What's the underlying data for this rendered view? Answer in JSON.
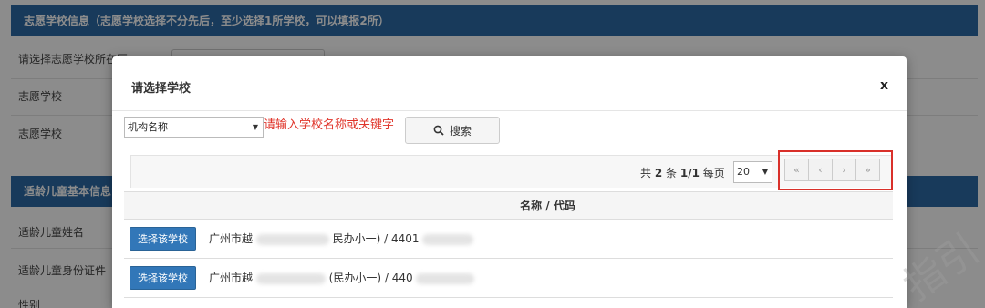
{
  "background": {
    "section1_title": "志愿学校信息（志愿学校选择不分先后，至少选择1所学校，可以填报2所）",
    "label_area": "请选择志愿学校所在区",
    "label_school1": "志愿学校",
    "label_school2": "志愿学校",
    "section2_title": "适龄儿童基本信息",
    "label_name": "适龄儿童姓名",
    "label_id": "适龄儿童身份证件",
    "label_gender": "性别"
  },
  "modal": {
    "title": "请选择学校",
    "close": "x",
    "search": {
      "select_value": "机构名称",
      "placeholder": "请输入学校名称或关键字",
      "button_label": "搜索"
    },
    "pager": {
      "total_prefix": "共",
      "total_count": "2",
      "total_suffix": "条",
      "pages": "1/1",
      "per_page_label": "每页",
      "page_size": "20",
      "first": "«",
      "prev": "‹",
      "next": "›",
      "last": "»"
    },
    "grid": {
      "header": "名称 / 代码",
      "rows": [
        {
          "button": "选择该学校",
          "prefix": "广州市越",
          "middle": "民办小一) / 4401"
        },
        {
          "button": "选择该学校",
          "prefix": "广州市越",
          "middle": "(民办小一) / 440"
        }
      ]
    }
  },
  "watermark": "指引",
  "colors": {
    "header_blue": "#2d6aa6",
    "button_blue": "#3277b8",
    "highlight_red": "#d9302a",
    "placeholder_red": "#e0352b"
  }
}
